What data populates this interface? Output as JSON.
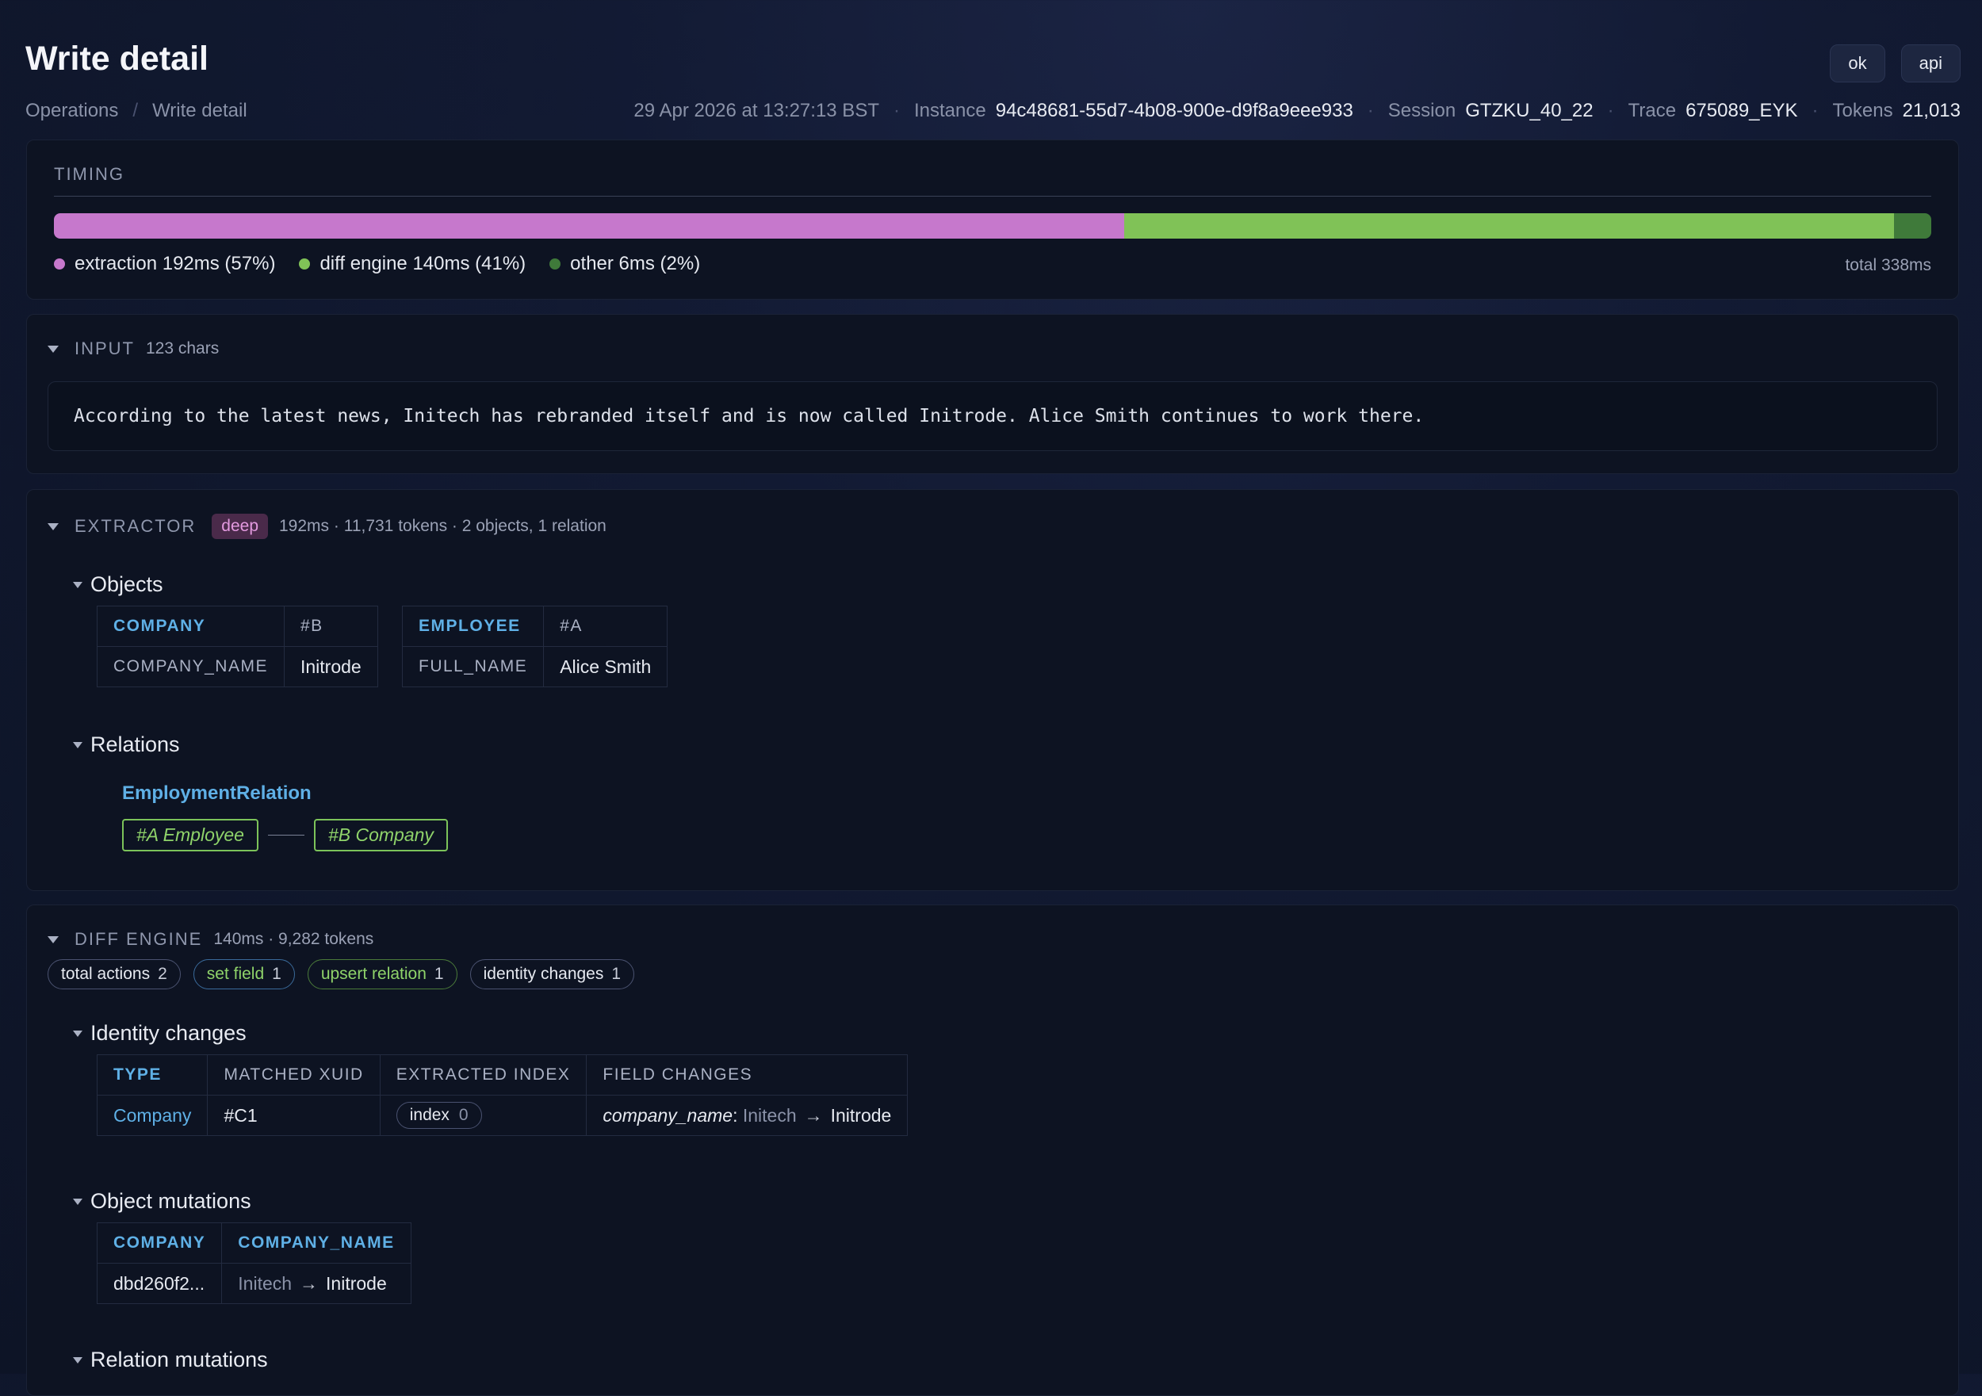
{
  "header": {
    "title": "Write detail",
    "buttons": [
      "ok",
      "api"
    ],
    "breadcrumb": [
      "Operations",
      "/",
      "Write detail"
    ],
    "timestamp": "29 Apr 2026 at 13:27:13 BST",
    "instance_label": "Instance",
    "instance": "94c48681-55d7-4b08-900e-d9f8a9eee933",
    "session_label": "Session",
    "session": "GTZKU_40_22",
    "trace_label": "Trace",
    "trace": "675089_EYK",
    "tokens_label": "Tokens",
    "tokens": "21,013"
  },
  "timing": {
    "label": "TIMING",
    "segments": [
      {
        "label": "extraction 192ms (57%)",
        "fraction": 0.57,
        "color": "#c678cc"
      },
      {
        "label": "diff engine 140ms (41%)",
        "fraction": 0.41,
        "color": "#80c257"
      },
      {
        "label": "other 6ms (2%)",
        "fraction": 0.02,
        "color": "#3f7a3a"
      }
    ],
    "total": "total 338ms"
  },
  "input": {
    "label": "INPUT",
    "chars": "123 chars",
    "text": "According to the latest news, Initech has rebranded itself and is now called Initrode. Alice Smith continues to work there."
  },
  "extractor": {
    "label": "EXTRACTOR",
    "mode": "deep",
    "stats": "192ms · 11,731 tokens · 2 objects, 1 relation",
    "objects_title": "Objects",
    "objects": [
      {
        "type": "COMPANY",
        "id": "#B",
        "field": "COMPANY_NAME",
        "value": "Initrode"
      },
      {
        "type": "EMPLOYEE",
        "id": "#A",
        "field": "FULL_NAME",
        "value": "Alice Smith"
      }
    ],
    "relations_title": "Relations",
    "relation_name": "EmploymentRelation",
    "relation_from": "#A Employee",
    "relation_to": "#B Company"
  },
  "diff": {
    "label": "DIFF ENGINE",
    "stats": "140ms · 9,282 tokens",
    "pills": [
      {
        "label": "total actions",
        "count": "2"
      },
      {
        "label": "set field",
        "count": "1"
      },
      {
        "label": "upsert relation",
        "count": "1"
      },
      {
        "label": "identity changes",
        "count": "1"
      }
    ],
    "identity_title": "Identity changes",
    "identity_headers": [
      "TYPE",
      "MATCHED XUID",
      "EXTRACTED INDEX",
      "FIELD CHANGES"
    ],
    "identity_row": {
      "type": "Company",
      "xuid": "#C1",
      "index_label": "index",
      "index_value": "0",
      "field": "company_name",
      "from": "Initech",
      "to": "Initrode"
    },
    "mutations_title": "Object mutations",
    "mutations_headers": [
      "COMPANY",
      "COMPANY_NAME"
    ],
    "mutations_row": {
      "id": "dbd260f2...",
      "from": "Initech",
      "to": "Initrode"
    },
    "relation_mutations_title": "Relation mutations"
  }
}
